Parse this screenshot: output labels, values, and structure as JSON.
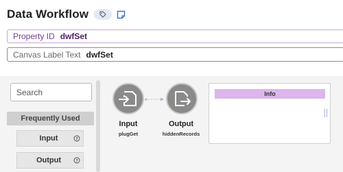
{
  "header": {
    "title": "Data Workflow",
    "tag_icon": "tag-icon",
    "note_icon": "note-icon"
  },
  "property": {
    "label": "Property ID",
    "value": "dwfSet"
  },
  "canvas_label": {
    "label": "Canvas Label Text",
    "value": "dwfSet"
  },
  "palette": {
    "search_placeholder": "Search",
    "section_title": "Frequently Used",
    "items": [
      {
        "label": "Input",
        "icon": "help-icon"
      },
      {
        "label": "Output",
        "icon": "help-icon"
      }
    ]
  },
  "nodes": [
    {
      "title": "Input",
      "subtitle": "plugGet",
      "icon": "input-node-icon"
    },
    {
      "title": "Output",
      "subtitle": "hiddenRecords",
      "icon": "output-node-icon"
    }
  ],
  "info_panel": {
    "title": "Info"
  },
  "colors": {
    "accent_purple": "#c7a6d7",
    "node_fill": "#8a8a8a",
    "info_header": "#dcb6ec"
  }
}
